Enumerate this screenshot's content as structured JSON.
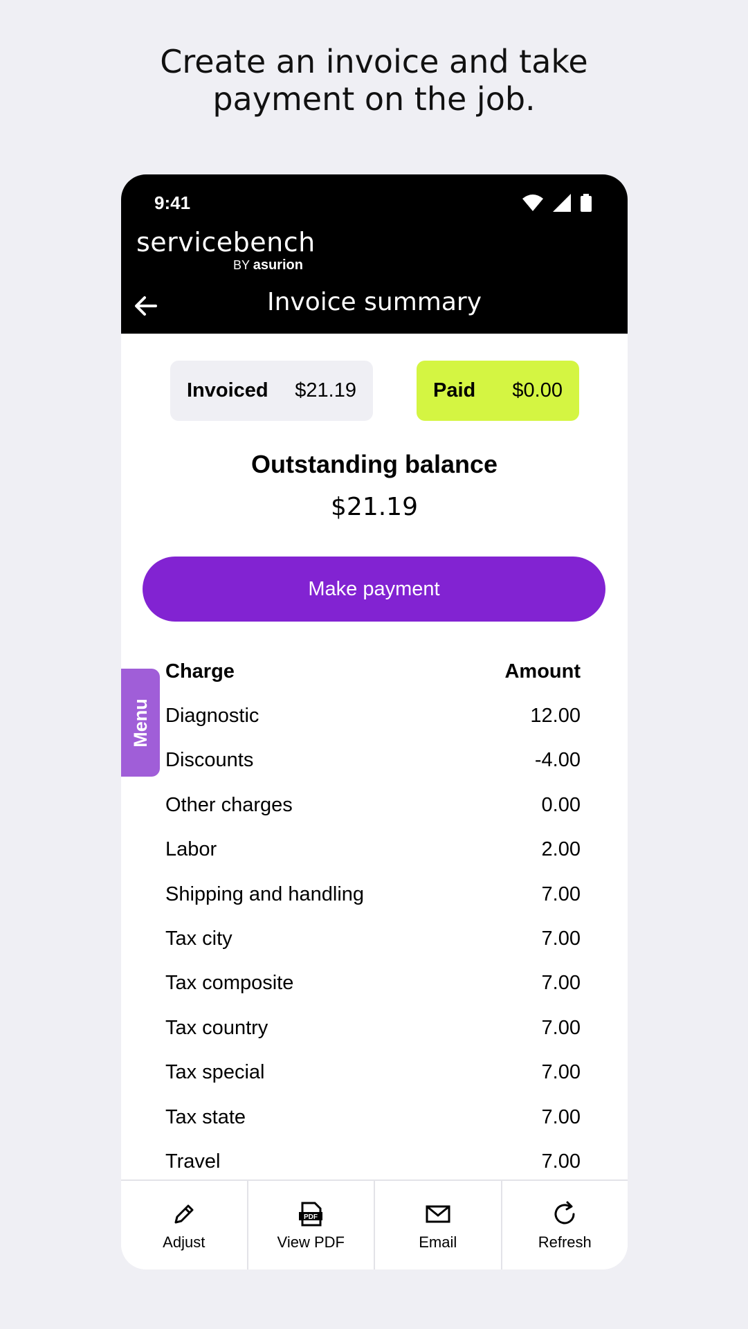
{
  "headline": {
    "line1": "Create an invoice and take",
    "line2": "payment on the job."
  },
  "status_bar": {
    "time": "9:41",
    "icons": [
      "wifi-icon",
      "signal-icon",
      "battery-icon"
    ]
  },
  "brand": {
    "name": "servicebench",
    "by": "BY",
    "parent": "asurion"
  },
  "nav": {
    "title": "Invoice summary"
  },
  "summary": {
    "invoiced_label": "Invoiced",
    "invoiced_value": "$21.19",
    "paid_label": "Paid",
    "paid_value": "$0.00",
    "balance_label": "Outstanding balance",
    "balance_value": "$21.19"
  },
  "actions": {
    "make_payment": "Make payment"
  },
  "menu_tab": "Menu",
  "table": {
    "headers": {
      "charge": "Charge",
      "amount": "Amount"
    },
    "rows": [
      {
        "charge": "Diagnostic",
        "amount": "12.00"
      },
      {
        "charge": "Discounts",
        "amount": "-4.00"
      },
      {
        "charge": "Other charges",
        "amount": "0.00"
      },
      {
        "charge": "Labor",
        "amount": "2.00"
      },
      {
        "charge": "Shipping and handling",
        "amount": "7.00"
      },
      {
        "charge": "Tax city",
        "amount": "7.00"
      },
      {
        "charge": "Tax composite",
        "amount": "7.00"
      },
      {
        "charge": "Tax country",
        "amount": "7.00"
      },
      {
        "charge": "Tax special",
        "amount": "7.00"
      },
      {
        "charge": "Tax state",
        "amount": "7.00"
      },
      {
        "charge": "Travel",
        "amount": "7.00"
      }
    ]
  },
  "bottom_bar": {
    "adjust": "Adjust",
    "view_pdf": "View PDF",
    "email": "Email",
    "refresh": "Refresh"
  },
  "colors": {
    "primary": "#8223d2",
    "paid_bg": "#d4f542",
    "menu_tab": "#a05ed8",
    "page_bg": "#efeff4"
  }
}
